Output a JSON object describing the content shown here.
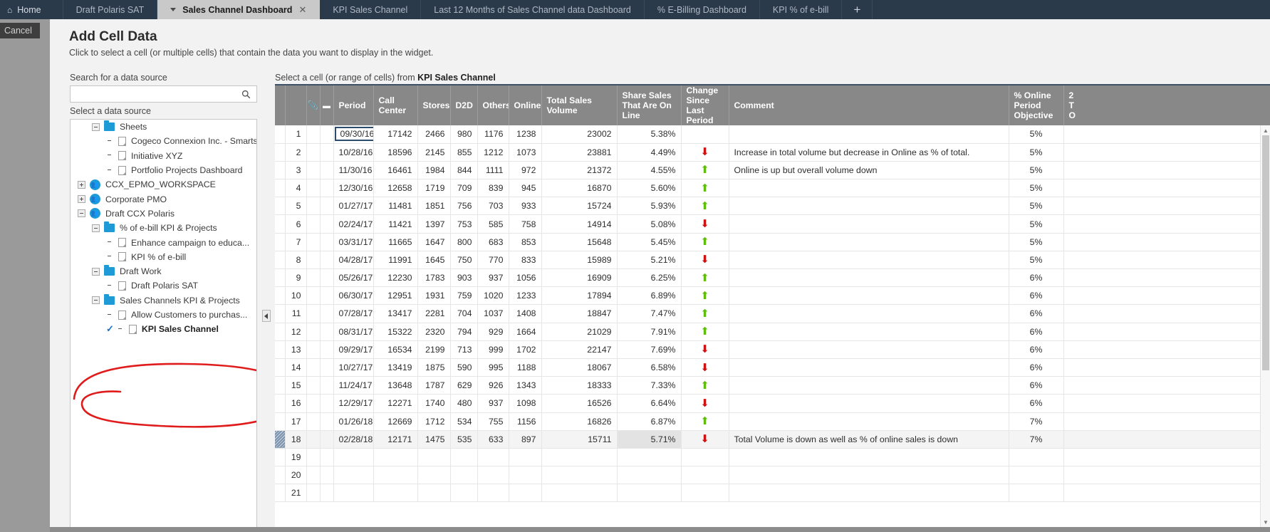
{
  "tabs": [
    {
      "label": "Home",
      "icon": "home-icon",
      "active": false
    },
    {
      "label": "Draft Polaris SAT",
      "active": false
    },
    {
      "label": "Sales Channel Dashboard",
      "active": true
    },
    {
      "label": "KPI Sales Channel",
      "active": false
    },
    {
      "label": "Last 12 Months of Sales Channel data Dashboard",
      "active": false
    },
    {
      "label": "% E-Billing Dashboard",
      "active": false
    },
    {
      "label": "KPI % of e-bill",
      "active": false
    },
    {
      "label": "+",
      "active": false
    }
  ],
  "cancel_label": "Cancel",
  "dialog": {
    "title": "Add Cell Data",
    "subtitle": "Click to select a cell (or multiple cells) that contain the data you want to display in the widget."
  },
  "search": {
    "label": "Search for a data source",
    "value": "",
    "placeholder": "",
    "icon": "search-icon"
  },
  "tree": {
    "label": "Select a data source",
    "items": [
      {
        "label": "Sheets",
        "icon": "folder-icon",
        "toggle": "minus",
        "indent": 1,
        "selected": false
      },
      {
        "label": "Cogeco Connexion Inc. - Smarts...",
        "icon": "sheet-icon",
        "toggle": "none",
        "indent": 2,
        "selected": false
      },
      {
        "label": "Initiative XYZ",
        "icon": "sheet-icon",
        "toggle": "none",
        "indent": 2,
        "selected": false
      },
      {
        "label": "Portfolio Projects Dashboard",
        "icon": "sheet-icon",
        "toggle": "none",
        "indent": 2,
        "selected": false
      },
      {
        "label": "CCX_EPMO_WORKSPACE",
        "icon": "workspace-icon",
        "toggle": "plus",
        "indent": 0,
        "selected": false
      },
      {
        "label": "Corporate PMO",
        "icon": "workspace-icon",
        "toggle": "plus",
        "indent": 0,
        "selected": false
      },
      {
        "label": "Draft CCX Polaris",
        "icon": "workspace-icon",
        "toggle": "minus",
        "indent": 0,
        "selected": false
      },
      {
        "label": "% of e-bill KPI & Projects",
        "icon": "folder-icon",
        "toggle": "minus",
        "indent": 1,
        "selected": false
      },
      {
        "label": "Enhance campaign to educa...",
        "icon": "sheet-icon",
        "toggle": "none",
        "indent": 2,
        "selected": false
      },
      {
        "label": "KPI % of e-bill",
        "icon": "sheet-icon",
        "toggle": "none",
        "indent": 2,
        "selected": false
      },
      {
        "label": "Draft Work",
        "icon": "folder-icon",
        "toggle": "minus",
        "indent": 1,
        "selected": false
      },
      {
        "label": "Draft Polaris SAT",
        "icon": "sheet-icon",
        "toggle": "none",
        "indent": 2,
        "selected": false
      },
      {
        "label": "Sales Channels KPI & Projects",
        "icon": "folder-icon",
        "toggle": "minus",
        "indent": 1,
        "selected": false
      },
      {
        "label": "Allow Customers to purchas...",
        "icon": "sheet-icon",
        "toggle": "none",
        "indent": 2,
        "selected": false
      },
      {
        "label": "KPI Sales Channel",
        "icon": "sheet-icon",
        "toggle": "none",
        "indent": 2,
        "selected": true,
        "check": "checkmark-icon"
      }
    ]
  },
  "grid": {
    "caption_prefix": "Select a cell (or range of cells) from ",
    "caption_source": "KPI Sales Channel",
    "columns": [
      {
        "key": "rowhandle",
        "label": ""
      },
      {
        "key": "rownum",
        "label": ""
      },
      {
        "key": "attach",
        "label": "attachment-icon"
      },
      {
        "key": "note",
        "label": "comment-icon"
      },
      {
        "key": "period",
        "label": "Period"
      },
      {
        "key": "call_center",
        "label": "Call Center"
      },
      {
        "key": "stores",
        "label": "Stores"
      },
      {
        "key": "d2d",
        "label": "D2D"
      },
      {
        "key": "others",
        "label": "Others"
      },
      {
        "key": "online",
        "label": "Online"
      },
      {
        "key": "total",
        "label": "Total Sales Volume"
      },
      {
        "key": "share",
        "label": "Share Sales That Are On Line"
      },
      {
        "key": "change",
        "label": "Change Since Last Period"
      },
      {
        "key": "comment",
        "label": "Comment"
      },
      {
        "key": "objective",
        "label": "% Online Period Objective"
      },
      {
        "key": "clipped",
        "label": "2 T O"
      }
    ],
    "rows": [
      {
        "n": "1",
        "period": "09/30/16",
        "call_center": "17142",
        "stores": "2466",
        "d2d": "980",
        "others": "1176",
        "online": "1238",
        "total": "23002",
        "share": "5.38%",
        "change": "",
        "comment": "",
        "objective": "5%",
        "selected_cell": true,
        "current": false
      },
      {
        "n": "2",
        "period": "10/28/16",
        "call_center": "18596",
        "stores": "2145",
        "d2d": "855",
        "others": "1212",
        "online": "1073",
        "total": "23881",
        "share": "4.49%",
        "change": "down",
        "comment": "Increase in total volume but decrease in Online as % of total.",
        "objective": "5%",
        "selected_cell": false,
        "current": false
      },
      {
        "n": "3",
        "period": "11/30/16",
        "call_center": "16461",
        "stores": "1984",
        "d2d": "844",
        "others": "1111",
        "online": "972",
        "total": "21372",
        "share": "4.55%",
        "change": "up",
        "comment": "Online is up but overall volume down",
        "objective": "5%",
        "selected_cell": false,
        "current": false
      },
      {
        "n": "4",
        "period": "12/30/16",
        "call_center": "12658",
        "stores": "1719",
        "d2d": "709",
        "others": "839",
        "online": "945",
        "total": "16870",
        "share": "5.60%",
        "change": "up",
        "comment": "",
        "objective": "5%",
        "selected_cell": false,
        "current": false
      },
      {
        "n": "5",
        "period": "01/27/17",
        "call_center": "11481",
        "stores": "1851",
        "d2d": "756",
        "others": "703",
        "online": "933",
        "total": "15724",
        "share": "5.93%",
        "change": "up",
        "comment": "",
        "objective": "5%",
        "selected_cell": false,
        "current": false
      },
      {
        "n": "6",
        "period": "02/24/17",
        "call_center": "11421",
        "stores": "1397",
        "d2d": "753",
        "others": "585",
        "online": "758",
        "total": "14914",
        "share": "5.08%",
        "change": "down",
        "comment": "",
        "objective": "5%",
        "selected_cell": false,
        "current": false
      },
      {
        "n": "7",
        "period": "03/31/17",
        "call_center": "11665",
        "stores": "1647",
        "d2d": "800",
        "others": "683",
        "online": "853",
        "total": "15648",
        "share": "5.45%",
        "change": "up",
        "comment": "",
        "objective": "5%",
        "selected_cell": false,
        "current": false
      },
      {
        "n": "8",
        "period": "04/28/17",
        "call_center": "11991",
        "stores": "1645",
        "d2d": "750",
        "others": "770",
        "online": "833",
        "total": "15989",
        "share": "5.21%",
        "change": "down",
        "comment": "",
        "objective": "5%",
        "selected_cell": false,
        "current": false
      },
      {
        "n": "9",
        "period": "05/26/17",
        "call_center": "12230",
        "stores": "1783",
        "d2d": "903",
        "others": "937",
        "online": "1056",
        "total": "16909",
        "share": "6.25%",
        "change": "up",
        "comment": "",
        "objective": "6%",
        "selected_cell": false,
        "current": false
      },
      {
        "n": "10",
        "period": "06/30/17",
        "call_center": "12951",
        "stores": "1931",
        "d2d": "759",
        "others": "1020",
        "online": "1233",
        "total": "17894",
        "share": "6.89%",
        "change": "up",
        "comment": "",
        "objective": "6%",
        "selected_cell": false,
        "current": false
      },
      {
        "n": "11",
        "period": "07/28/17",
        "call_center": "13417",
        "stores": "2281",
        "d2d": "704",
        "others": "1037",
        "online": "1408",
        "total": "18847",
        "share": "7.47%",
        "change": "up",
        "comment": "",
        "objective": "6%",
        "selected_cell": false,
        "current": false
      },
      {
        "n": "12",
        "period": "08/31/17",
        "call_center": "15322",
        "stores": "2320",
        "d2d": "794",
        "others": "929",
        "online": "1664",
        "total": "21029",
        "share": "7.91%",
        "change": "up",
        "comment": "",
        "objective": "6%",
        "selected_cell": false,
        "current": false
      },
      {
        "n": "13",
        "period": "09/29/17",
        "call_center": "16534",
        "stores": "2199",
        "d2d": "713",
        "others": "999",
        "online": "1702",
        "total": "22147",
        "share": "7.69%",
        "change": "down",
        "comment": "",
        "objective": "6%",
        "selected_cell": false,
        "current": false
      },
      {
        "n": "14",
        "period": "10/27/17",
        "call_center": "13419",
        "stores": "1875",
        "d2d": "590",
        "others": "995",
        "online": "1188",
        "total": "18067",
        "share": "6.58%",
        "change": "down",
        "comment": "",
        "objective": "6%",
        "selected_cell": false,
        "current": false
      },
      {
        "n": "15",
        "period": "11/24/17",
        "call_center": "13648",
        "stores": "1787",
        "d2d": "629",
        "others": "926",
        "online": "1343",
        "total": "18333",
        "share": "7.33%",
        "change": "up",
        "comment": "",
        "objective": "6%",
        "selected_cell": false,
        "current": false
      },
      {
        "n": "16",
        "period": "12/29/17",
        "call_center": "12271",
        "stores": "1740",
        "d2d": "480",
        "others": "937",
        "online": "1098",
        "total": "16526",
        "share": "6.64%",
        "change": "down",
        "comment": "",
        "objective": "6%",
        "selected_cell": false,
        "current": false
      },
      {
        "n": "17",
        "period": "01/26/18",
        "call_center": "12669",
        "stores": "1712",
        "d2d": "534",
        "others": "755",
        "online": "1156",
        "total": "16826",
        "share": "6.87%",
        "change": "up",
        "comment": "",
        "objective": "7%",
        "selected_cell": false,
        "current": false
      },
      {
        "n": "18",
        "period": "02/28/18",
        "call_center": "12171",
        "stores": "1475",
        "d2d": "535",
        "others": "633",
        "online": "897",
        "total": "15711",
        "share": "5.71%",
        "change": "down",
        "comment": "Total Volume is down as well as % of online sales is down",
        "objective": "7%",
        "selected_cell": false,
        "current": true
      },
      {
        "n": "19",
        "period": "",
        "call_center": "",
        "stores": "",
        "d2d": "",
        "others": "",
        "online": "",
        "total": "",
        "share": "",
        "change": "",
        "comment": "",
        "objective": "",
        "selected_cell": false,
        "current": false
      },
      {
        "n": "20",
        "period": "",
        "call_center": "",
        "stores": "",
        "d2d": "",
        "others": "",
        "online": "",
        "total": "",
        "share": "",
        "change": "",
        "comment": "",
        "objective": "",
        "selected_cell": false,
        "current": false
      },
      {
        "n": "21",
        "period": "",
        "call_center": "",
        "stores": "",
        "d2d": "",
        "others": "",
        "online": "",
        "total": "",
        "share": "",
        "change": "",
        "comment": "",
        "objective": "",
        "selected_cell": false,
        "current": false
      }
    ]
  },
  "colors": {
    "accent": "#1e9ad6",
    "header_bar": "#2b3a4a",
    "grid_header": "#888888",
    "up": "#5fbe0c",
    "down": "#cf1111",
    "annotation": "#e01b1b"
  },
  "collapse_handle_icon": "chevron-left-icon"
}
